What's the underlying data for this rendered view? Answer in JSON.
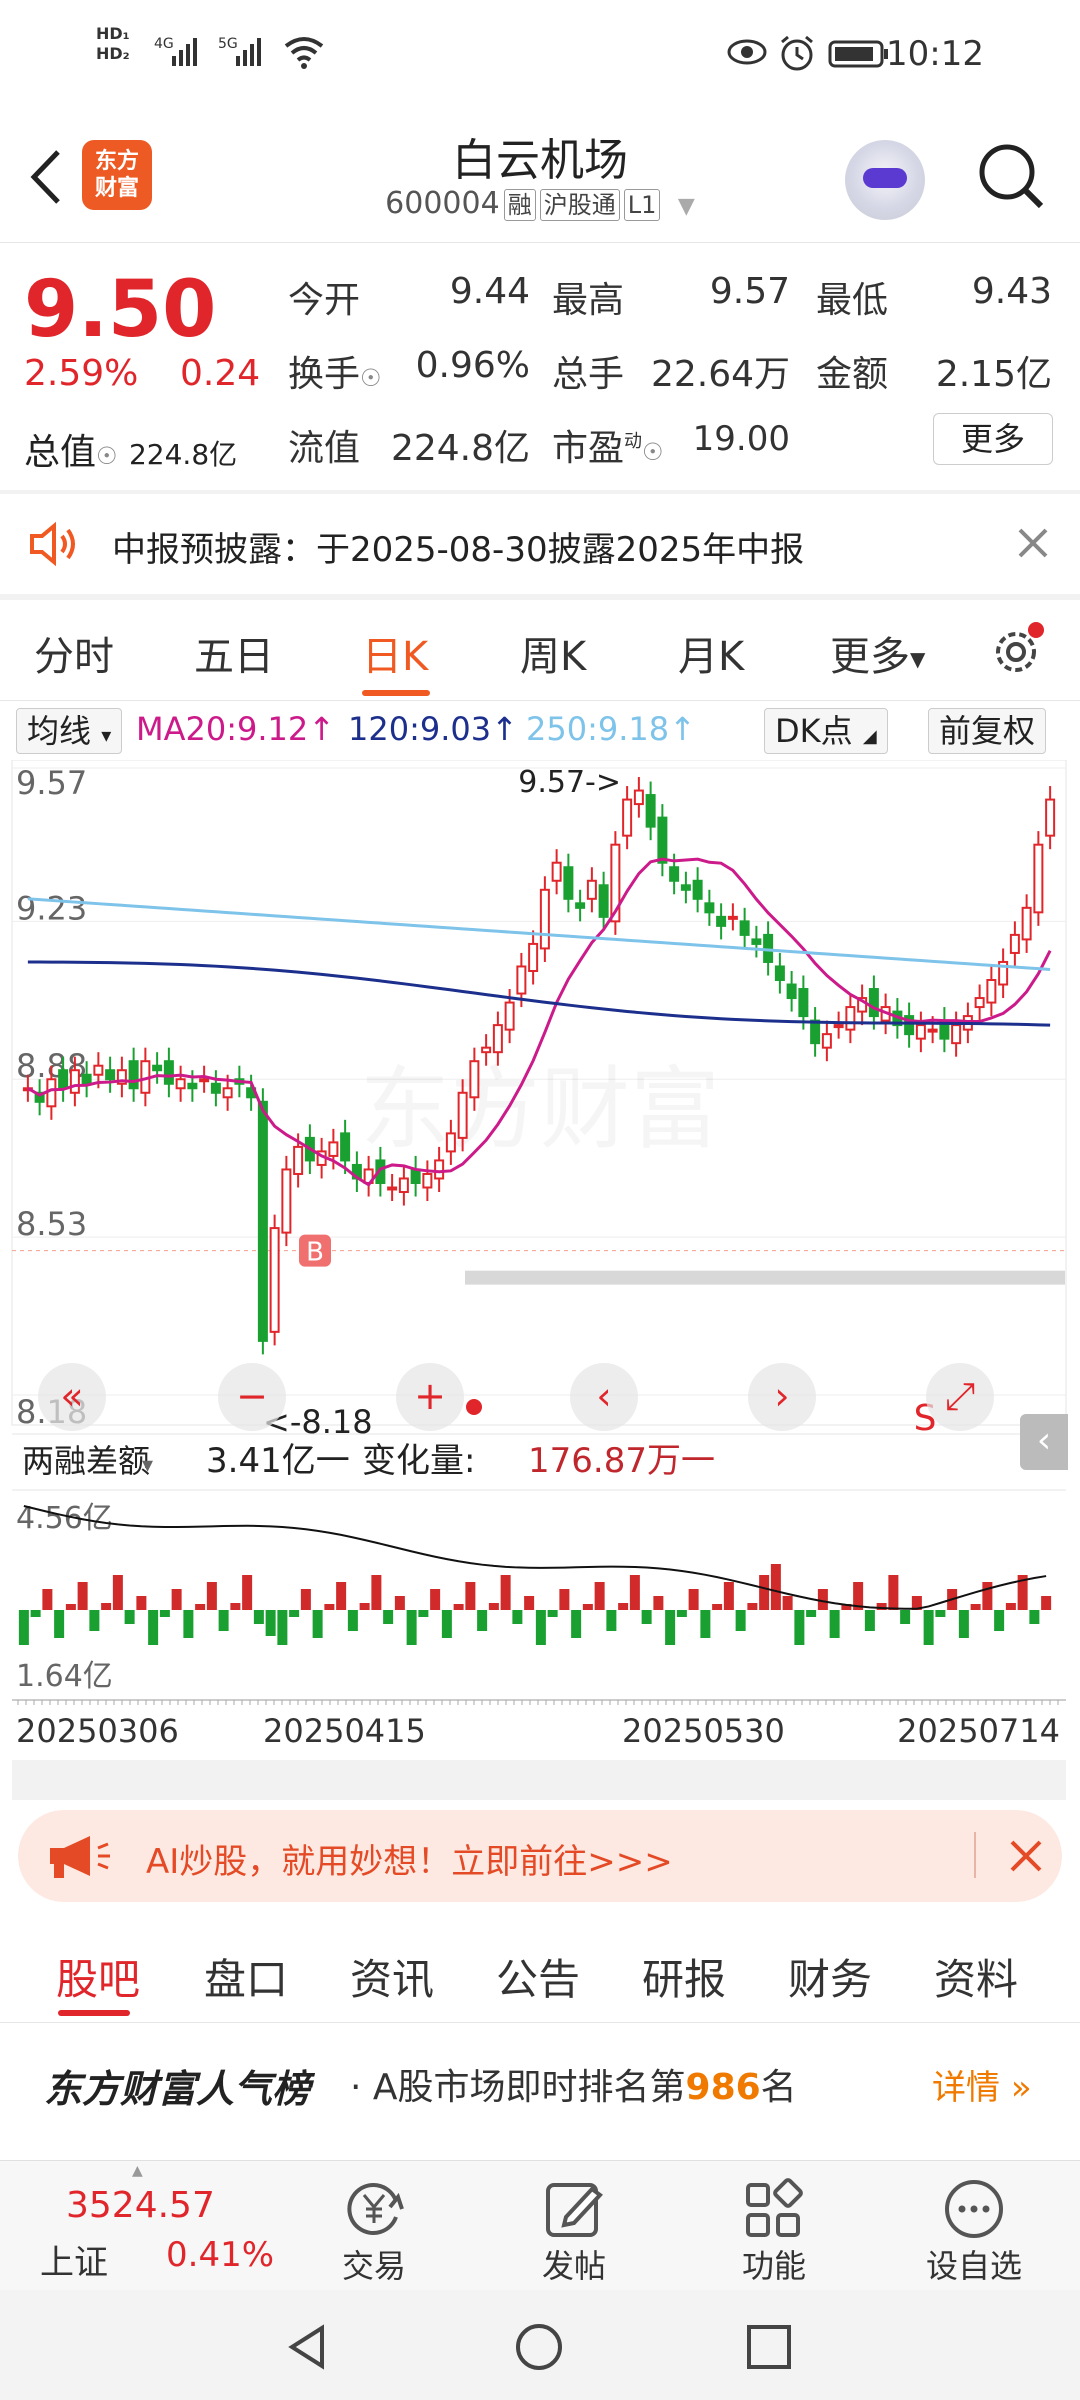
{
  "status": {
    "time": "10:12",
    "network": "HD 4G 5G",
    "icons": [
      "eye-icon",
      "alarm-icon",
      "battery-icon",
      "wifi-icon",
      "signal-icon"
    ]
  },
  "header": {
    "back_icon": "back-arrow-icon",
    "logo_line1": "东方",
    "logo_line2": "财富",
    "title": "白云机场",
    "code": "600004",
    "tags": [
      "融",
      "沪股通",
      "L1"
    ],
    "avatar_icon": "robot-avatar-icon",
    "search_icon": "search-icon"
  },
  "quote": {
    "price": "9.50",
    "change_pct": "2.59%",
    "change": "0.24",
    "cap_label": "总值",
    "cap_value": "224.8亿",
    "open_label": "今开",
    "open": "9.44",
    "high_label": "最高",
    "high": "9.57",
    "low_label": "最低",
    "low": "9.43",
    "turnover_label": "换手",
    "turnover": "0.96%",
    "volume_label": "总手",
    "volume": "22.64万",
    "amount_label": "金额",
    "amount": "2.15亿",
    "float_label": "流值",
    "float": "224.8亿",
    "pe_label": "市盈",
    "pe_super": "动",
    "pe": "19.00",
    "more_label": "更多"
  },
  "notice": {
    "text": "中报预披露：于2025-08-30披露2025年中报",
    "icon": "speaker-icon",
    "close_icon": "close-icon"
  },
  "tabs": {
    "items": [
      "分时",
      "五日",
      "日K",
      "周K",
      "月K",
      "更多"
    ],
    "active": "日K",
    "settings_icon": "gear-icon"
  },
  "chart": {
    "ma_label": "均线",
    "ma20": "MA20:9.12",
    "ma120": "120:9.03",
    "ma250": "250:9.18",
    "dk_label": "DK点",
    "adjust_label": "前复权",
    "price_ticks": [
      "9.57",
      "9.23",
      "8.88",
      "8.53",
      "8.18"
    ],
    "high_marker": "9.57->",
    "low_marker": "<-8.18",
    "buy_marker": "B",
    "sell_marker": "S",
    "margin_label": "两融差额",
    "margin_value": "3.41亿一",
    "margin_change_label": "变化量:",
    "margin_change": "176.87万一",
    "margin_ticks": [
      "4.56亿",
      "1.64亿"
    ],
    "dates": [
      "20250306",
      "20250415",
      "20250530",
      "20250714"
    ],
    "colors": {
      "up": "#e0262b",
      "down": "#19a030",
      "ma20": "#cc1a8a",
      "ma120": "#1c2f8c",
      "ma250": "#7ec3ea"
    }
  },
  "chart_data": {
    "type": "candlestick",
    "title": "",
    "ylim": [
      8.18,
      9.57
    ],
    "x_range": [
      "20250306",
      "20250714"
    ],
    "indicators": {
      "MA20": 9.12,
      "MA120": 9.03,
      "MA250": 9.18
    },
    "high": 9.57,
    "low": 8.18,
    "secondary": {
      "type": "bar",
      "name": "两融差额",
      "ylim": [
        "1.64亿",
        "4.56亿"
      ]
    }
  },
  "banner": {
    "text": "AI炒股，就用妙想！立即前往>>>",
    "icon": "megaphone-icon",
    "close_icon": "close-icon"
  },
  "bottom_tabs": {
    "items": [
      "股吧",
      "盘口",
      "资讯",
      "公告",
      "研报",
      "财务",
      "资料"
    ],
    "active": "股吧"
  },
  "rank": {
    "brand": "东方财富人气榜",
    "prefix": "· A股市场即时排名第",
    "rank": "986",
    "suffix": "名",
    "link": "详情"
  },
  "bottom_nav": {
    "index_value": "3524.57",
    "index_name": "上证",
    "index_pct": "0.41%",
    "items": [
      {
        "label": "交易",
        "icon": "yen-cycle-icon"
      },
      {
        "label": "发帖",
        "icon": "edit-icon"
      },
      {
        "label": "功能",
        "icon": "grid-icon"
      },
      {
        "label": "设自选",
        "icon": "more-dots-icon"
      }
    ]
  },
  "system_nav": {
    "icons": [
      "triangle-back-icon",
      "circle-home-icon",
      "square-recent-icon"
    ]
  }
}
